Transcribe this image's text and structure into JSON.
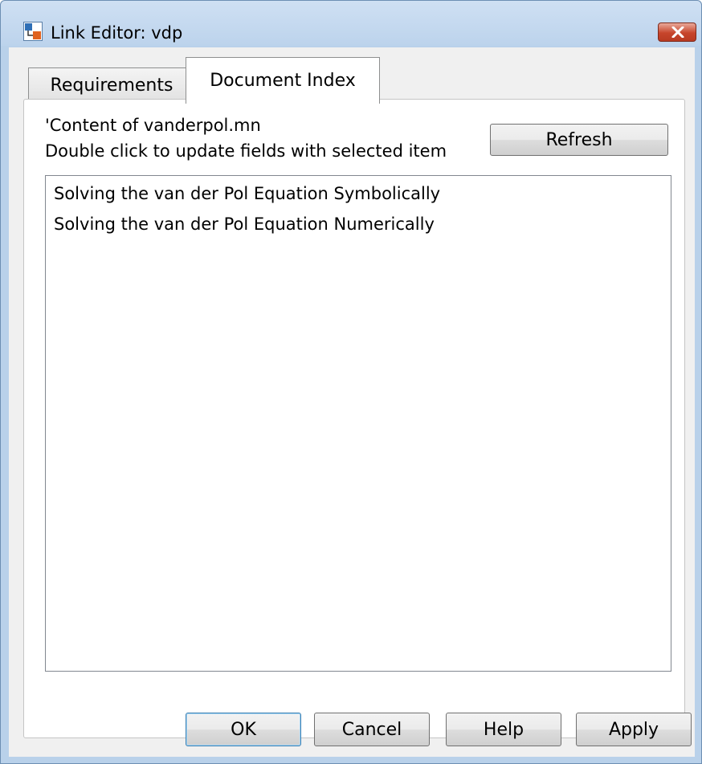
{
  "window": {
    "title": "Link Editor: vdp",
    "icon": "simulink-model-icon",
    "close_icon": "close-icon"
  },
  "tabs": [
    {
      "label": "Requirements",
      "selected": false
    },
    {
      "label": "Document Index",
      "selected": true
    }
  ],
  "document_index": {
    "content_label": "'Content of vanderpol.mn",
    "hint_label": "Double click to update fields with selected item",
    "refresh_label": "Refresh",
    "items": [
      "Solving the van der Pol Equation Symbolically",
      "Solving the van der Pol Equation Numerically"
    ]
  },
  "buttons": {
    "ok": "OK",
    "cancel": "Cancel",
    "help": "Help",
    "apply": "Apply"
  },
  "colors": {
    "title_bar": "#bcd3ec",
    "close_button": "#c7452b",
    "default_button_border": "#3c7fb1"
  }
}
